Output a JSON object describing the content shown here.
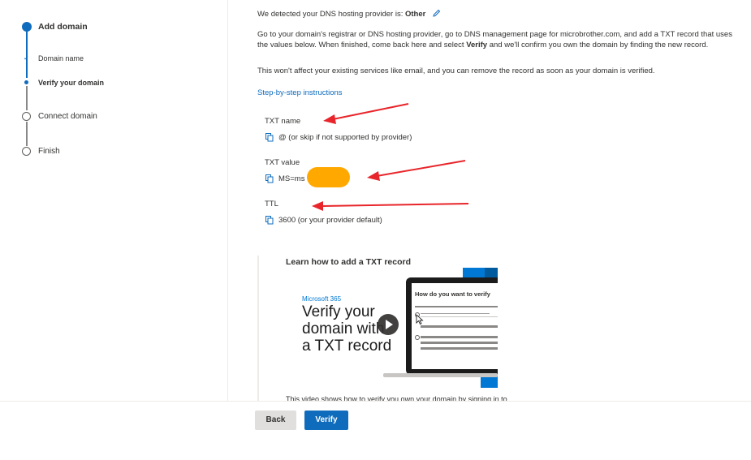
{
  "stepper": {
    "steps": [
      {
        "label": "Add domain",
        "state": "current"
      },
      {
        "label": "Domain name",
        "state": "done"
      },
      {
        "label": "Verify your domain",
        "state": "current-sub"
      },
      {
        "label": "Connect domain",
        "state": "pending"
      },
      {
        "label": "Finish",
        "state": "pending"
      }
    ]
  },
  "main": {
    "provider_prefix": "We detected your DNS hosting provider is: ",
    "provider_name": "Other",
    "instructions_1": "Go to your domain's registrar or DNS hosting provider, go to DNS management page for microbrother.com, and add a TXT record that uses the values below. When finished, come back here and select ",
    "instructions_verify": "Verify",
    "instructions_2": " and we'll confirm you own the domain by finding the new record.",
    "note": "This won't affect your existing services like email, and you can remove the record as soon as your domain is verified.",
    "instructions_link": "Step-by-step instructions",
    "records": [
      {
        "title": "TXT name",
        "value": "@ (or skip if not supported by provider)"
      },
      {
        "title": "TXT value",
        "value": "MS=ms"
      },
      {
        "title": "TTL",
        "value": "3600 (or your provider default)"
      }
    ],
    "video": {
      "heading": "Learn how to add a TXT record",
      "brand": "Microsoft 365",
      "line1": "Verify your",
      "line2": "domain with",
      "line3": "a TXT record",
      "screen_title": "How do you want to verify",
      "caption": "This video shows how to verify you own your domain by signing in to"
    }
  },
  "footer": {
    "back_label": "Back",
    "verify_label": "Verify"
  },
  "colors": {
    "accent": "#0f6cbd",
    "annotation_arrow": "#e8252a",
    "redaction": "#ffa800"
  }
}
